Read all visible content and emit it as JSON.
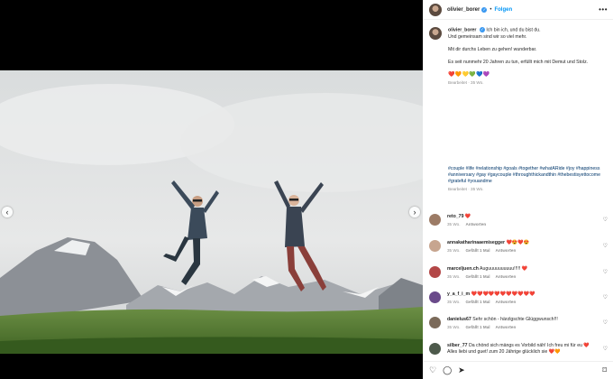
{
  "header": {
    "username": "olivier_borer",
    "verified_mark": "✓",
    "separator": "•",
    "follow_label": "Folgen",
    "more_icon": "•••"
  },
  "caption": {
    "username": "olivier_borer",
    "line1": "Ich bin ich, und du bist du.",
    "line2": "Und gemeinsam sind wir so viel mehr.",
    "line3": "Mit dir durchs Leben zu gehen! wunderbar.",
    "line4": "Es seit nunmehr 20 Jahren zu tun, erfüllt mich mit Demut und Stolz.",
    "hearts": "❤️🧡💛💚💙💜",
    "edited": "Bearbeitet · 35 Wo.",
    "hashtags": "#couple #life #relationship #goals #together #whatARide #joy #happiness #anniversary #gay #gaycouple #throughthickandthin #thebestisyettocome #grateful #youandme",
    "time": "Bearbeitet · 35 Wo."
  },
  "comments": [
    {
      "username": "reto_79",
      "text": "❤️",
      "time": "35 Wo.",
      "likes": "",
      "reply": "Antworten",
      "avatar_color": "#9c7b66"
    },
    {
      "username": "annakatharinaaemisegger",
      "text": "❤️😍❤️😍",
      "time": "35 Wo.",
      "likes": "Gefällt 1 Mal",
      "reply": "Antworten",
      "avatar_color": "#c7a58f"
    },
    {
      "username": "marceljuen.ch",
      "text": "Auguuuuuuuuuu!!!!! ❤️",
      "time": "35 Wo.",
      "likes": "Gefällt 1 Mal",
      "reply": "Antworten",
      "avatar_color": "#b34747"
    },
    {
      "username": "y_a_f_i_m",
      "text": "❤️❤️❤️❤️❤️❤️❤️❤️❤️❤️❤️",
      "time": "35 Wo.",
      "likes": "Gefällt 1 Mal",
      "reply": "Antworten",
      "avatar_color": "#6a4a8a"
    },
    {
      "username": "danielus67",
      "text": "Sehr schön - härzlgschte Glüggwunsch!!!",
      "time": "35 Wo.",
      "likes": "Gefällt 1 Mal",
      "reply": "Antworten",
      "avatar_color": "#7b6a5a"
    },
    {
      "username": "silber_77",
      "text": "Da chönd sich mängs es Vorbild näh! Ich freu mi für eu ❤️ Alles liebi und guet! zum 20 Jährige glücklich sie ❤️🧡",
      "time": "35 Wo.",
      "likes": "",
      "reply": "",
      "avatar_color": "#4d5a4b"
    }
  ],
  "actions": {
    "like_icon": "♡",
    "comment_icon": "◯",
    "share_icon": "➤",
    "save_icon": "⌑"
  },
  "media": {
    "prev_icon": "‹",
    "next_icon": "›"
  }
}
